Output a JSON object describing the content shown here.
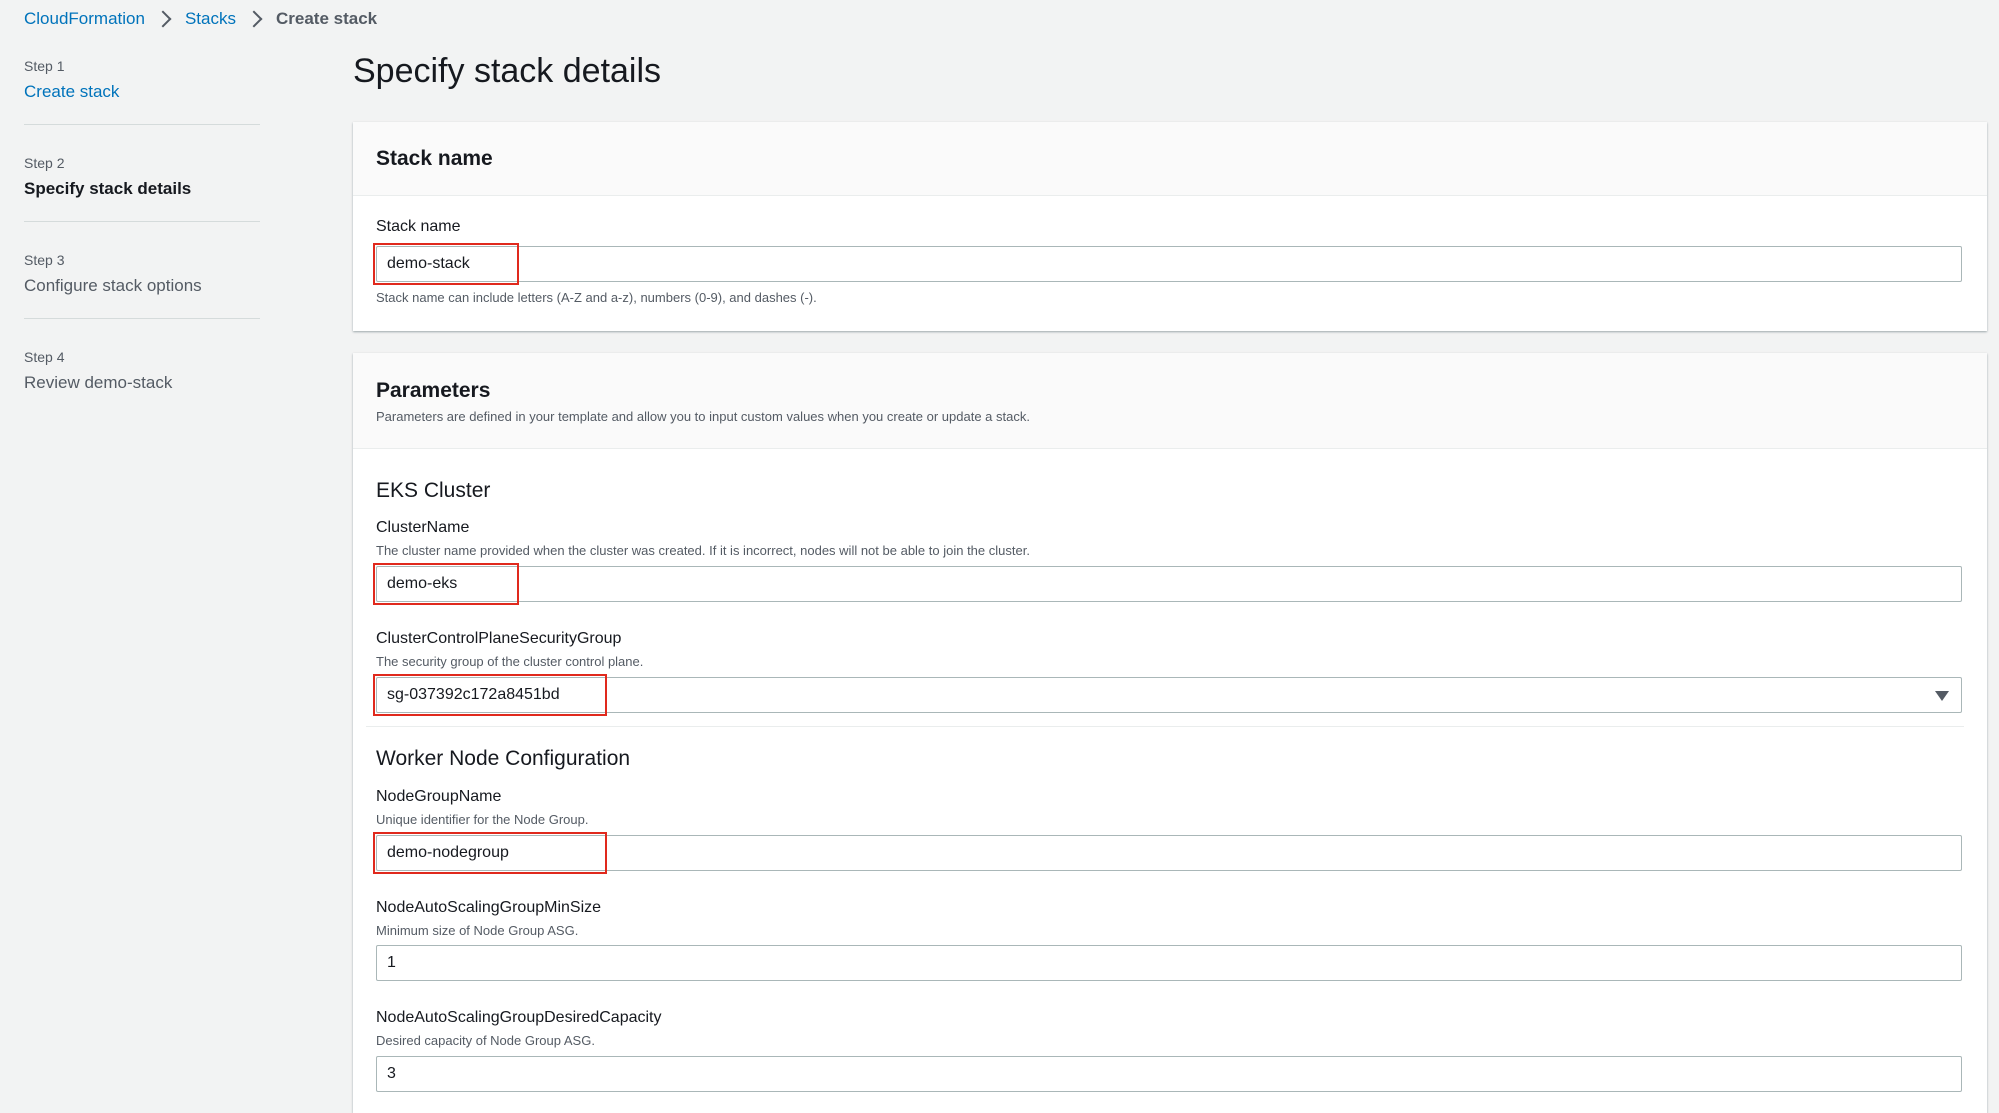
{
  "breadcrumb": {
    "root": "CloudFormation",
    "stacks": "Stacks",
    "current": "Create stack"
  },
  "steps": [
    {
      "num": "Step 1",
      "label": "Create stack"
    },
    {
      "num": "Step 2",
      "label": "Specify stack details"
    },
    {
      "num": "Step 3",
      "label": "Configure stack options"
    },
    {
      "num": "Step 4",
      "label": "Review demo-stack"
    }
  ],
  "page_title": "Specify stack details",
  "stack_name_section": {
    "title": "Stack name",
    "label": "Stack name",
    "value": "demo-stack",
    "hint": "Stack name can include letters (A-Z and a-z), numbers (0-9), and dashes (-)."
  },
  "parameters": {
    "title": "Parameters",
    "description": "Parameters are defined in your template and allow you to input custom values when you create or update a stack.",
    "eks_cluster": {
      "title": "EKS Cluster",
      "cluster_name": {
        "label": "ClusterName",
        "description": "The cluster name provided when the cluster was created. If it is incorrect, nodes will not be able to join the cluster.",
        "value": "demo-eks"
      },
      "security_group": {
        "label": "ClusterControlPlaneSecurityGroup",
        "description": "The security group of the cluster control plane.",
        "value": "sg-037392c172a8451bd"
      }
    },
    "worker_node": {
      "title": "Worker Node Configuration",
      "node_group_name": {
        "label": "NodeGroupName",
        "description": "Unique identifier for the Node Group.",
        "value": "demo-nodegroup"
      },
      "min_size": {
        "label": "NodeAutoScalingGroupMinSize",
        "description": "Minimum size of Node Group ASG.",
        "value": "1"
      },
      "desired_capacity": {
        "label": "NodeAutoScalingGroupDesiredCapacity",
        "description": "Desired capacity of Node Group ASG.",
        "value": "3"
      }
    }
  },
  "colors": {
    "link": "#0073bb",
    "highlight": "#e0291d",
    "background": "#f2f3f3"
  }
}
